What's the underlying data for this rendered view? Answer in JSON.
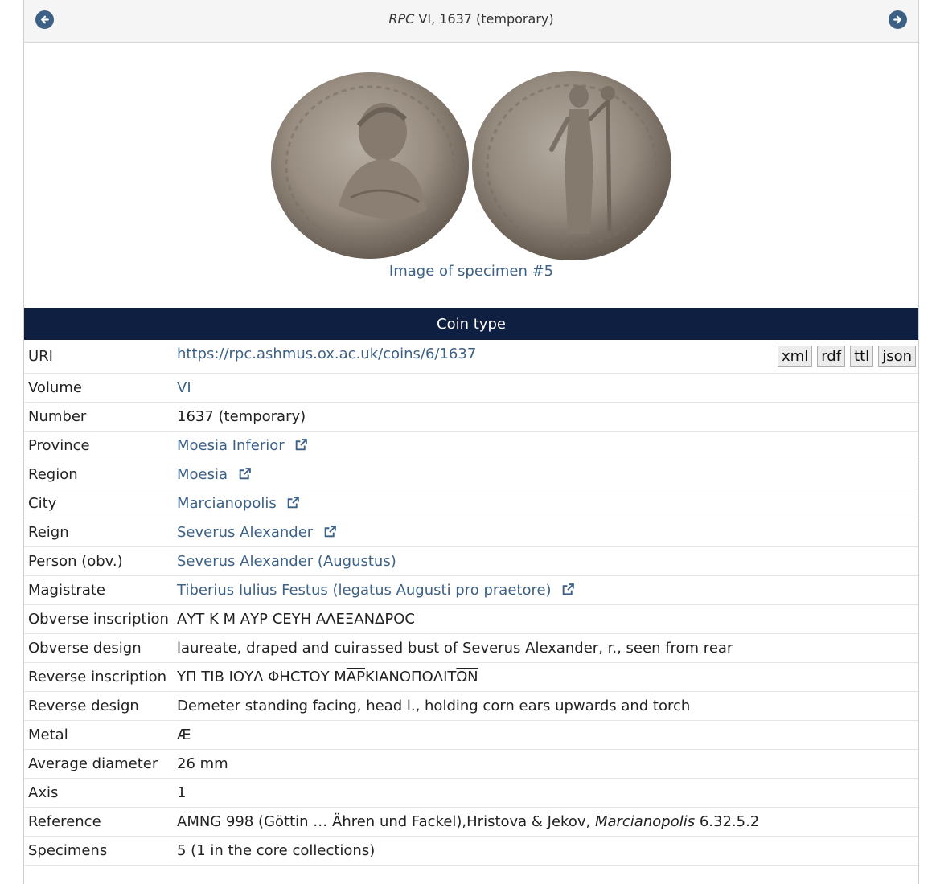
{
  "header": {
    "title_series": "RPC",
    "title_rest": " VI, 1637 (temporary)"
  },
  "image": {
    "caption": "Image of specimen #5"
  },
  "section": {
    "title": "Coin type"
  },
  "formats": [
    "xml",
    "rdf",
    "ttl",
    "json"
  ],
  "fields": {
    "uri": {
      "label": "URI",
      "value": "https://rpc.ashmus.ox.ac.uk/coins/6/1637"
    },
    "volume": {
      "label": "Volume",
      "value": "VI"
    },
    "number": {
      "label": "Number",
      "value": "1637 (temporary)"
    },
    "province": {
      "label": "Province",
      "value": "Moesia Inferior"
    },
    "region": {
      "label": "Region",
      "value": "Moesia"
    },
    "city": {
      "label": "City",
      "value": "Marcianopolis"
    },
    "reign": {
      "label": "Reign",
      "value": "Severus Alexander"
    },
    "person": {
      "label": "Person (obv.)",
      "value": "Severus Alexander (Augustus)"
    },
    "magistrate": {
      "label": "Magistrate",
      "value": "Tiberius Iulius Festus (legatus Augusti pro praetore)"
    },
    "obv_inscription": {
      "label": "Obverse inscription",
      "value": "ΑΥΤ Κ Μ ΑΥΡ ϹΕΥΗ ΑΛΕΞΑΝΔΡΟϹ"
    },
    "obv_design": {
      "label": "Obverse design",
      "value": "laureate, draped and cuirassed bust of Severus Alexander, r., seen from rear"
    },
    "rev_inscription": {
      "label": "Reverse inscription",
      "part1": "ΥΠ ΤΙΒ ΙΟΥΛ ΦΗϹΤΟΥ Μ",
      "part2": "ΑΡ",
      "part3": "ΚΙΑΝΟΠΟΛΙΤ",
      "part4": "ΩΝ"
    },
    "rev_design": {
      "label": "Reverse design",
      "value": "Demeter standing facing, head l., holding corn ears upwards and torch"
    },
    "metal": {
      "label": "Metal",
      "value": "Æ"
    },
    "diameter": {
      "label": "Average diameter",
      "value": "26 mm"
    },
    "axis": {
      "label": "Axis",
      "value": "1"
    },
    "reference": {
      "label": "Reference",
      "prefix": "AMNG 998 (Göttin … Ähren und Fackel),Hristova & Jekov, ",
      "title": "Marcianopolis",
      "suffix": " 6.32.5.2"
    },
    "specimens": {
      "label": "Specimens",
      "value": "5 (1 in the core collections)"
    }
  }
}
